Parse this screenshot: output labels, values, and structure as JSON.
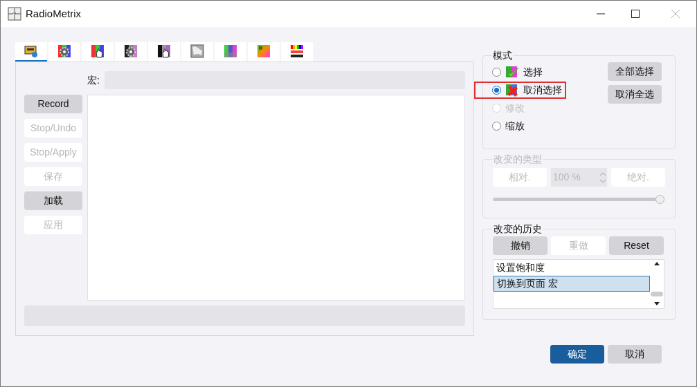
{
  "window": {
    "title": "RadioMetrix"
  },
  "tabs": [
    {
      "kind": "cassette",
      "selected": true
    },
    {
      "kind": "gear-rgb",
      "selected": false
    },
    {
      "kind": "hand-rgb",
      "selected": false
    },
    {
      "kind": "gear-gray",
      "selected": false
    },
    {
      "kind": "hand-gray",
      "selected": false
    },
    {
      "kind": "texture",
      "selected": false
    },
    {
      "kind": "bars",
      "selected": false
    },
    {
      "kind": "square",
      "selected": false
    },
    {
      "kind": "rainbow",
      "selected": false
    }
  ],
  "macro": {
    "label": "宏:"
  },
  "macro_buttons": [
    {
      "label": "Record",
      "disabled": false
    },
    {
      "label": "Stop/Undo",
      "disabled": true
    },
    {
      "label": "Stop/Apply",
      "disabled": true
    },
    {
      "label": "保存",
      "disabled": true
    },
    {
      "label": "加载",
      "disabled": false
    },
    {
      "label": "应用",
      "disabled": true
    }
  ],
  "mode": {
    "title": "模式",
    "options": [
      {
        "label": "选择",
        "kind": "check",
        "selected": false,
        "disabled": false,
        "highlighted": false
      },
      {
        "label": "取消选择",
        "kind": "cross",
        "selected": true,
        "disabled": false,
        "highlighted": true
      },
      {
        "label": "修改",
        "selected": false,
        "disabled": true,
        "highlighted": false
      },
      {
        "label": "缩放",
        "selected": false,
        "disabled": false,
        "highlighted": false
      }
    ],
    "buttons": [
      "全部选择",
      "取消全选"
    ]
  },
  "change_type": {
    "title": "改变的类型",
    "disabled": true,
    "relative": "相对.",
    "spin_value": "100 %",
    "absolute": "绝对.",
    "level": 1.0
  },
  "history": {
    "title": "改变的历史",
    "buttons": [
      {
        "label": "撤销",
        "disabled": false
      },
      {
        "label": "重做",
        "disabled": true
      },
      {
        "label": "Reset",
        "disabled": false
      }
    ],
    "items": [
      {
        "label": "设置饱和度",
        "selected": false
      },
      {
        "label": "切换到页面 宏",
        "selected": true
      }
    ]
  },
  "footer": {
    "ok": "确定",
    "cancel": "取消"
  }
}
